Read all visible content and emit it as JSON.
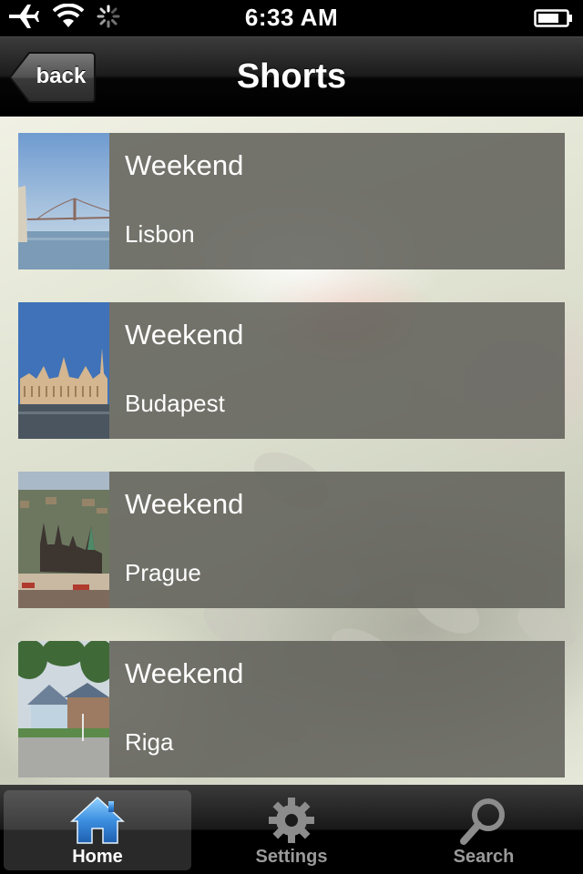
{
  "status_bar": {
    "time": "6:33 AM",
    "icons": [
      "airplane-icon",
      "wifi-icon",
      "activity-spinner-icon",
      "battery-icon"
    ]
  },
  "nav": {
    "title": "Shorts",
    "back_label": "back"
  },
  "list": {
    "items": [
      {
        "title": "Weekend",
        "subtitle": "Lisbon",
        "thumb": "bridge-photo"
      },
      {
        "title": "Weekend",
        "subtitle": "Budapest",
        "thumb": "parliament-photo"
      },
      {
        "title": "Weekend",
        "subtitle": "Prague",
        "thumb": "castle-photo"
      },
      {
        "title": "Weekend",
        "subtitle": "Riga",
        "thumb": "house-photo"
      }
    ]
  },
  "tabs": [
    {
      "label": "Home",
      "icon": "home-icon",
      "selected": true
    },
    {
      "label": "Settings",
      "icon": "gear-icon",
      "selected": false
    },
    {
      "label": "Search",
      "icon": "magnifier-icon",
      "selected": false
    }
  ],
  "colors": {
    "tab_active_icon": "#3d8fe0",
    "cell_overlay": "#5c5c56"
  }
}
